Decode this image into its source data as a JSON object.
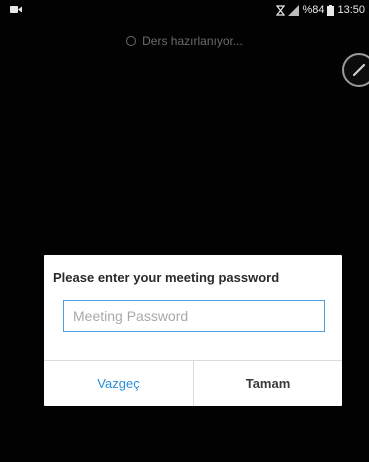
{
  "status_bar": {
    "left_icon": "video-camera-icon",
    "battery_text": "%84",
    "time": "13:50",
    "icons": [
      "alarm-icon",
      "signal-icon",
      "battery-icon"
    ]
  },
  "loading": {
    "text": "Ders hazırlanıyor...",
    "icon": "spinner-icon"
  },
  "floating_button": {
    "icon": "pencil-icon"
  },
  "dialog": {
    "title": "Please enter your meeting password",
    "password_placeholder": "Meeting Password",
    "password_value": "",
    "cancel_label": "Vazgeç",
    "ok_label": "Tamam"
  },
  "colors": {
    "background": "#020202",
    "dialog_bg": "#ffffff",
    "accent": "#2a8fd8",
    "input_border": "#4aa3df"
  }
}
